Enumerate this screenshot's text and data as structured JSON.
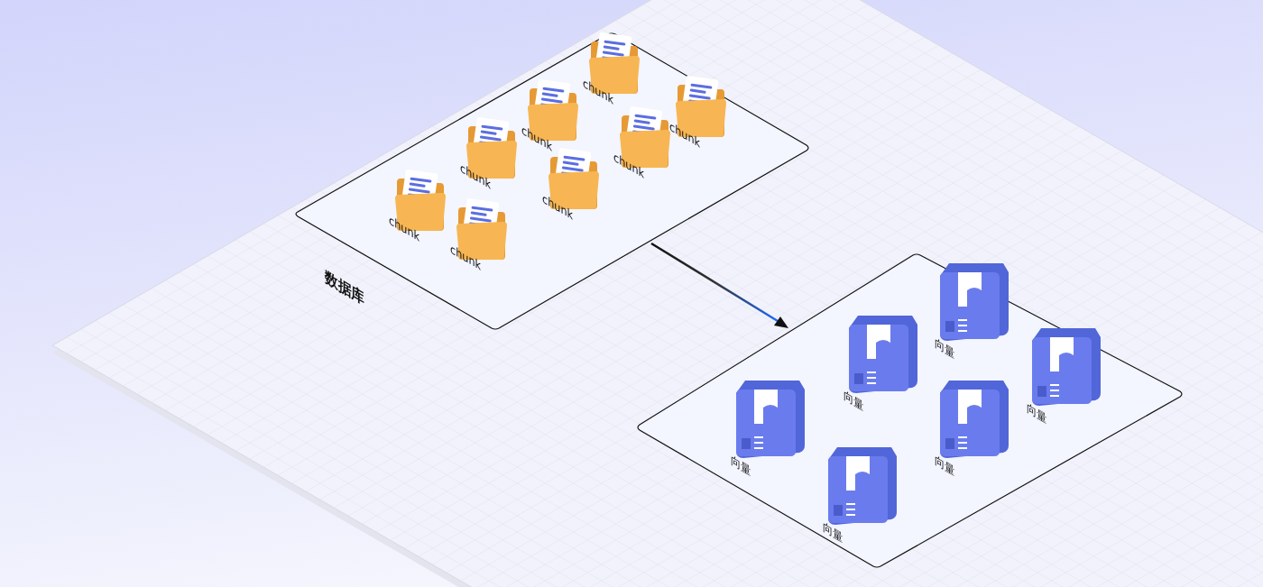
{
  "diagram": {
    "database": {
      "label": "数据库",
      "chunks": [
        {
          "label": "chunk"
        },
        {
          "label": "chunk"
        },
        {
          "label": "chunk"
        },
        {
          "label": "chunk"
        },
        {
          "label": "chunk"
        },
        {
          "label": "chunk"
        },
        {
          "label": "chunk"
        },
        {
          "label": "chunk"
        }
      ]
    },
    "vectors": [
      {
        "label": "向量"
      },
      {
        "label": "向量"
      },
      {
        "label": "向量"
      },
      {
        "label": "向量"
      },
      {
        "label": "向量"
      },
      {
        "label": "向量"
      }
    ]
  }
}
